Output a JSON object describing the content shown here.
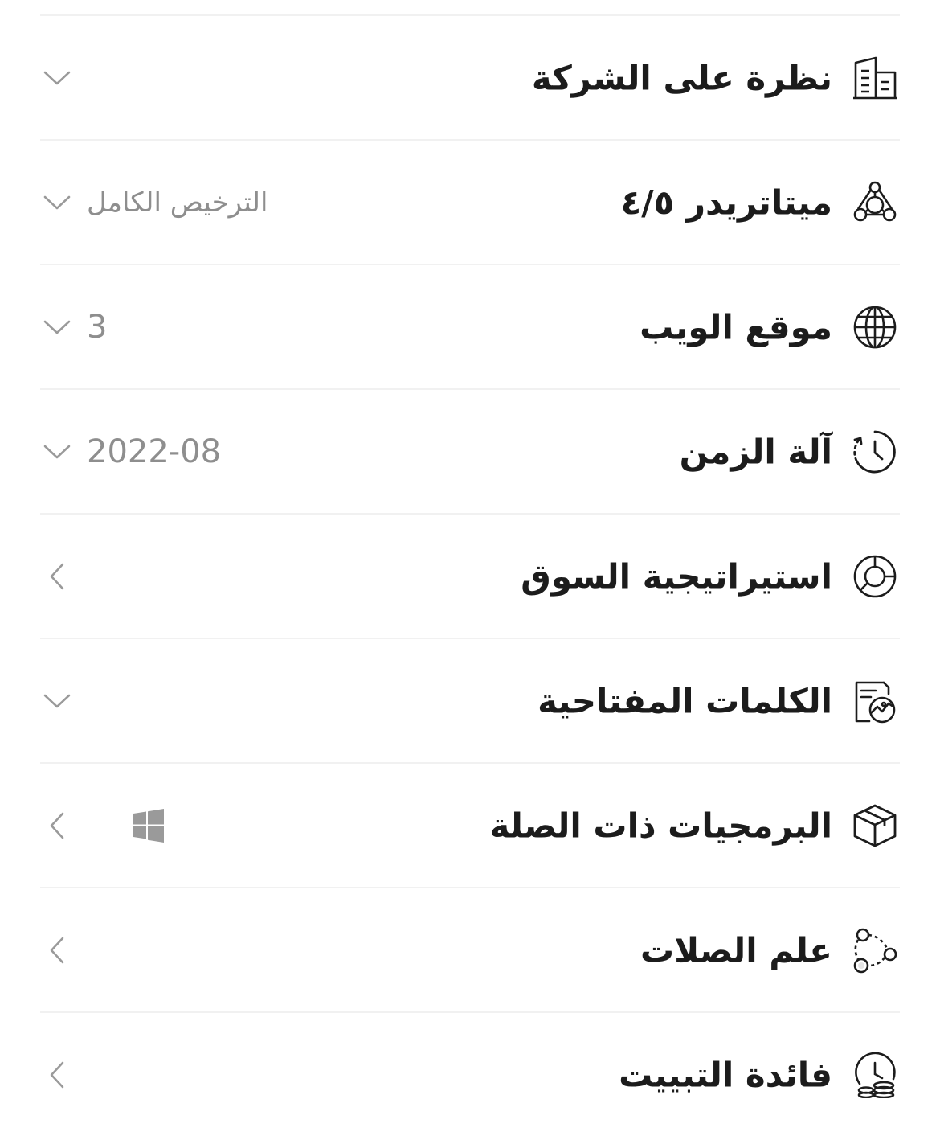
{
  "rows": [
    {
      "label": "نظرة على الشركة",
      "icon": "building-icon",
      "chevron": "down"
    },
    {
      "label": "ميتاتريدر ٤/٥",
      "value": "الترخيص الكامل",
      "icon": "molecule-icon",
      "chevron": "down"
    },
    {
      "label": "موقع الويب",
      "value": "3",
      "icon": "globe-icon",
      "chevron": "down"
    },
    {
      "label": "آلة الزمن",
      "value": "2022-08",
      "icon": "history-clock-icon",
      "chevron": "down"
    },
    {
      "label": "استيراتيجية السوق",
      "icon": "donut-chart-icon",
      "chevron": "left"
    },
    {
      "label": "الكلمات المفتاحية",
      "icon": "document-chart-icon",
      "chevron": "down"
    },
    {
      "label": "البرمجيات ذات الصلة",
      "icon": "box-icon",
      "badge_icon": "windows-icon",
      "chevron": "left"
    },
    {
      "label": "علم الصلات",
      "icon": "connections-icon",
      "chevron": "left"
    },
    {
      "label": "فائدة التبييت",
      "icon": "clock-coins-icon",
      "chevron": "left"
    }
  ],
  "colors": {
    "text": "#1c1c1c",
    "muted": "#8e8e8e",
    "divider": "#f1f1f1"
  }
}
